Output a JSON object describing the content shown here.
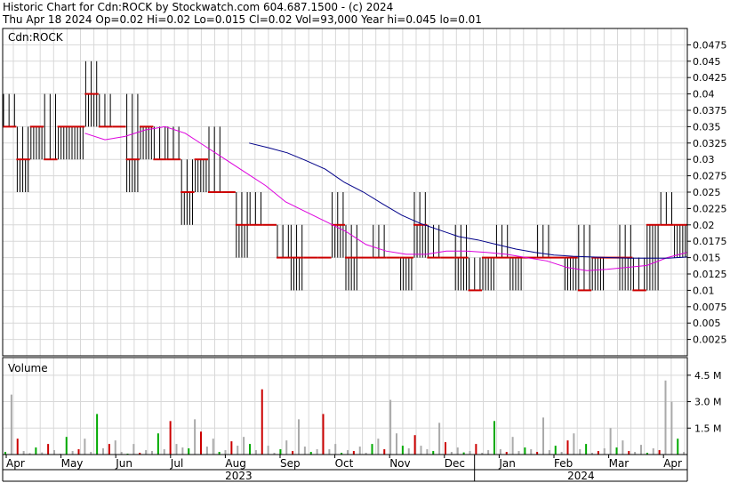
{
  "header": {
    "line1": "Historic Chart for Cdn:ROCK by Stockwatch.com 604.687.1500 - (c) 2024",
    "line2": "Thu Apr 18 2024   Op=0.02  Hi=0.02  Lo=0.015  Cl=0.02  Vol=93,000  Year hi=0.045  lo=0.01"
  },
  "price_panel": {
    "symbol": "Cdn:ROCK"
  },
  "volume_panel": {
    "label": "Volume"
  },
  "colors": {
    "ma_short": "#dd00dd",
    "ma_long": "#000088",
    "up_volume": "#00aa00",
    "down_volume": "#cc0000",
    "flat_volume": "#aaaaaa",
    "close_tick": "#cc0000",
    "grid": "#d8d8d8"
  },
  "chart_data": [
    {
      "type": "ohlc",
      "title": "Cdn:ROCK",
      "ylim": [
        0,
        0.05
      ],
      "y_ticks": [
        "0.0475",
        "0.045",
        "0.0425",
        "0.04",
        "0.0375",
        "0.035",
        "0.0325",
        "0.03",
        "0.0275",
        "0.025",
        "0.0225",
        "0.02",
        "0.0175",
        "0.015",
        "0.0125",
        "0.01",
        "0.0075",
        "0.005",
        "0.0025"
      ],
      "x_ticks": [
        "Apr",
        "May",
        "Jun",
        "Jul",
        "Aug",
        "Sep",
        "Oct",
        "Nov",
        "Dec",
        "Jan",
        "Feb",
        "Mar",
        "Apr"
      ],
      "years": [
        "2023",
        "2024"
      ],
      "series": [
        {
          "name": "close",
          "values": [
            0.035,
            0.03,
            0.035,
            0.03,
            0.035,
            0.035,
            0.04,
            0.035,
            0.035,
            0.03,
            0.035,
            0.03,
            0.03,
            0.025,
            0.03,
            0.025,
            0.025,
            0.02,
            0.02,
            0.02,
            0.015,
            0.015,
            0.015,
            0.015,
            0.02,
            0.015,
            0.015,
            0.015,
            0.015,
            0.015,
            0.02,
            0.015,
            0.015,
            0.015,
            0.01,
            0.015,
            0.015,
            0.015,
            0.015,
            0.015,
            0.015,
            0.015,
            0.01,
            0.015,
            0.015,
            0.015,
            0.01,
            0.02,
            0.02,
            0.02
          ]
        },
        {
          "name": "ma_short",
          "values": [
            0.034,
            0.033,
            0.0335,
            0.0345,
            0.035,
            0.034,
            0.032,
            0.03,
            0.028,
            0.026,
            0.0235,
            0.022,
            0.0205,
            0.019,
            0.017,
            0.016,
            0.0155,
            0.0155,
            0.016,
            0.016,
            0.0158,
            0.0155,
            0.015,
            0.0145,
            0.0135,
            0.013,
            0.0132,
            0.0135,
            0.0138,
            0.015,
            0.0158
          ]
        },
        {
          "name": "ma_long",
          "values": [
            0.0325,
            0.0318,
            0.031,
            0.0298,
            0.0285,
            0.0265,
            0.025,
            0.0232,
            0.0215,
            0.0202,
            0.0192,
            0.0182,
            0.0177,
            0.017,
            0.0163,
            0.0158,
            0.0154,
            0.0152,
            0.0151,
            0.015,
            0.0149,
            0.0149,
            0.0149,
            0.0151
          ]
        }
      ]
    },
    {
      "type": "bar",
      "title": "Volume",
      "ylim": [
        0,
        5500000
      ],
      "y_ticks": [
        "4.5 M",
        "3.0 M",
        "1.5 M"
      ],
      "series": [
        {
          "name": "volume",
          "values": [
            150000,
            3400000,
            900000,
            200000,
            80000,
            400000,
            120000,
            600000,
            250000,
            50000,
            1000000,
            200000,
            300000,
            900000,
            150000,
            2300000,
            350000,
            600000,
            800000,
            150000,
            50000,
            600000,
            100000,
            250000,
            200000,
            1200000,
            300000,
            1900000,
            600000,
            400000,
            350000,
            2000000,
            1300000,
            450000,
            900000,
            150000,
            250000,
            750000,
            500000,
            1000000,
            600000,
            250000,
            3700000,
            500000,
            100000,
            300000,
            800000,
            200000,
            2000000,
            450000,
            150000,
            300000,
            2300000,
            300000,
            600000,
            100000,
            250000,
            200000,
            450000,
            100000,
            600000,
            900000,
            300000,
            3100000,
            1200000,
            500000,
            350000,
            1100000,
            500000,
            300000,
            200000,
            1800000,
            700000,
            150000,
            400000,
            120000,
            200000,
            600000,
            100000,
            250000,
            1900000,
            300000,
            150000,
            1000000,
            200000,
            400000,
            300000,
            150000,
            2100000,
            250000,
            500000,
            150000,
            800000,
            1200000,
            300000,
            600000,
            100000,
            200000,
            350000,
            1500000,
            400000,
            800000,
            200000,
            150000,
            550000,
            100000,
            350000,
            250000,
            4200000,
            3000000,
            900000,
            150000
          ]
        }
      ]
    }
  ]
}
